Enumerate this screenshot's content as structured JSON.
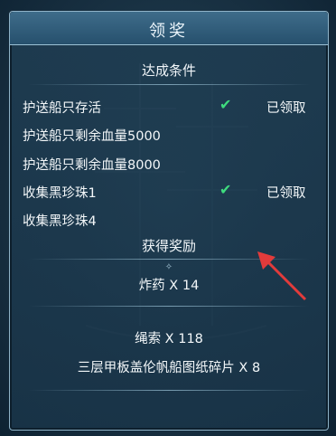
{
  "dialog": {
    "title": "领奖",
    "conditions_header": "达成条件",
    "conditions": [
      {
        "label": "护送船只存活",
        "checked": true,
        "status": "已领取"
      },
      {
        "label": "护送船只剩余血量5000",
        "checked": false,
        "status": ""
      },
      {
        "label": "护送船只剩余血量8000",
        "checked": false,
        "status": ""
      },
      {
        "label": "收集黑珍珠1",
        "checked": true,
        "status": "已领取"
      },
      {
        "label": "收集黑珍珠4",
        "checked": false,
        "status": ""
      }
    ],
    "rewards_header": "获得奖励",
    "rewards": [
      "炸药 X 14",
      "绳索 X 118",
      "三层甲板盖伦帆船图纸碎片 X 8"
    ]
  },
  "colors": {
    "check": "#3fdc7e",
    "arrow": "#e23b3b"
  }
}
